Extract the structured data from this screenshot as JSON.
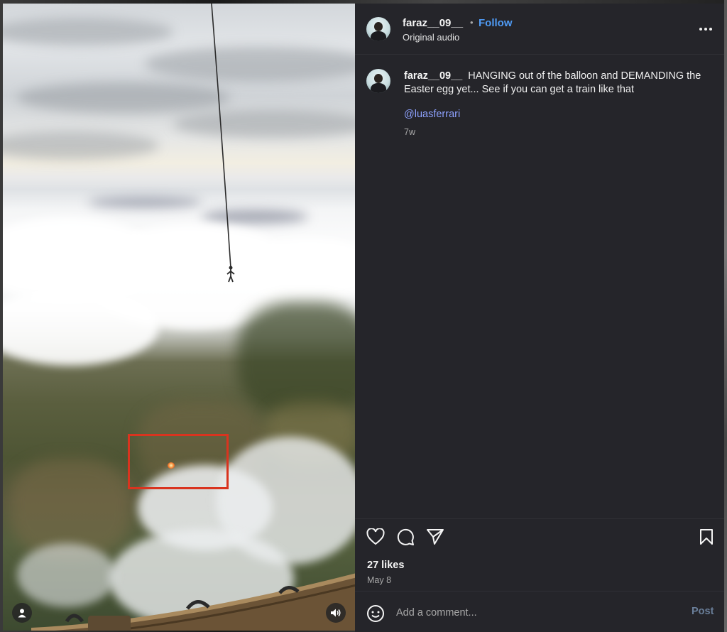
{
  "colors": {
    "panel_bg": "#25252a",
    "link_blue": "#4f9bf5",
    "mention_blue": "#8ea2ff",
    "highlight_red": "#d9341f"
  },
  "post": {
    "username": "faraz__09__",
    "follow_label": "Follow",
    "separator": "•",
    "audio_label": "Original audio",
    "more_icon": "more-horizontal-icon"
  },
  "caption": {
    "username": "faraz__09__",
    "text": "HANGING out of the balloon and DEMANDING the Easter egg yet... See if you can get a train like that",
    "mention": "@luasferrari",
    "time_ago": "7w"
  },
  "actions": {
    "icons": [
      "heart-icon",
      "comment-icon",
      "share-icon",
      "bookmark-icon"
    ],
    "likes": "27 likes",
    "date": "May 8"
  },
  "comment": {
    "placeholder": "Add a comment...",
    "post_label": "Post"
  },
  "media": {
    "icons": [
      "user-tag-icon",
      "volume-icon"
    ]
  }
}
